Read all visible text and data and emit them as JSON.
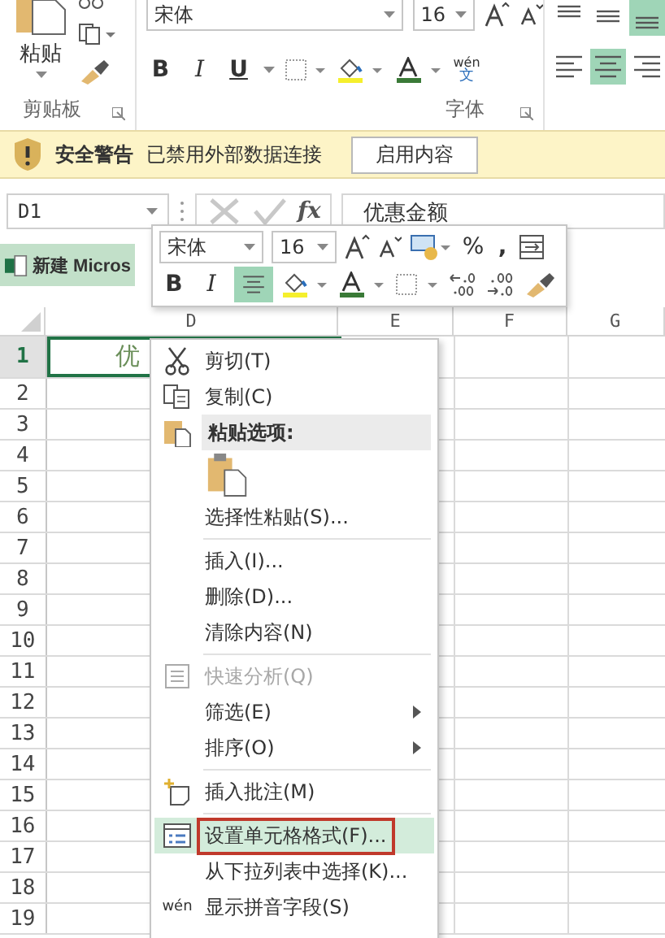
{
  "ribbon": {
    "clipboard": {
      "paste_label": "粘贴",
      "group_label": "剪贴板"
    },
    "font": {
      "font_name": "宋体",
      "font_size": "16",
      "bold": "B",
      "italic": "I",
      "underline": "U",
      "phonetic_top": "wén",
      "phonetic_bottom": "文",
      "group_label": "字体"
    },
    "alignment": [
      {
        "kind": "top",
        "selected": false
      },
      {
        "kind": "middle",
        "selected": false
      },
      {
        "kind": "bottom",
        "selected": true
      },
      {
        "kind": "left",
        "selected": false
      },
      {
        "kind": "center",
        "selected": true
      },
      {
        "kind": "right",
        "selected": false
      }
    ]
  },
  "security_bar": {
    "title": "安全警告",
    "message": "已禁用外部数据连接",
    "button": "启用内容"
  },
  "formula_bar": {
    "name_box": "D1",
    "function_label": "fx",
    "formula": "优惠金额"
  },
  "workbook_tab": "新建 Micros",
  "sheet": {
    "columns": [
      "D",
      "E",
      "F",
      "G"
    ],
    "rows": [
      "1",
      "2",
      "3",
      "4",
      "5",
      "6",
      "7",
      "8",
      "9",
      "10",
      "11",
      "12",
      "13",
      "14",
      "15",
      "16",
      "17",
      "18",
      "19"
    ],
    "cell_d1": "优"
  },
  "mini_toolbar": {
    "font_name": "宋体",
    "font_size": "16",
    "percent": "%",
    "comma": ",",
    "bold": "B",
    "italic": "I",
    "center_selected": true
  },
  "context_menu": [
    {
      "kind": "item",
      "label": "剪切(T)",
      "disabled": false,
      "submenu": false,
      "selected": false,
      "marked": false
    },
    {
      "kind": "item",
      "label": "复制(C)",
      "disabled": false,
      "submenu": false,
      "selected": false,
      "marked": false
    },
    {
      "kind": "header",
      "label": "粘贴选项:"
    },
    {
      "kind": "paste-options"
    },
    {
      "kind": "item",
      "label": "选择性粘贴(S)...",
      "disabled": false,
      "submenu": false,
      "selected": false,
      "marked": false
    },
    {
      "kind": "separator"
    },
    {
      "kind": "item",
      "label": "插入(I)...",
      "disabled": false,
      "submenu": false,
      "selected": false,
      "marked": false
    },
    {
      "kind": "item",
      "label": "删除(D)...",
      "disabled": false,
      "submenu": false,
      "selected": false,
      "marked": false
    },
    {
      "kind": "item",
      "label": "清除内容(N)",
      "disabled": false,
      "submenu": false,
      "selected": false,
      "marked": false
    },
    {
      "kind": "separator"
    },
    {
      "kind": "item",
      "label": "快速分析(Q)",
      "disabled": true,
      "submenu": false,
      "selected": false,
      "marked": false
    },
    {
      "kind": "item",
      "label": "筛选(E)",
      "disabled": false,
      "submenu": true,
      "selected": false,
      "marked": false
    },
    {
      "kind": "item",
      "label": "排序(O)",
      "disabled": false,
      "submenu": true,
      "selected": false,
      "marked": false
    },
    {
      "kind": "separator"
    },
    {
      "kind": "item",
      "label": "插入批注(M)",
      "disabled": false,
      "submenu": false,
      "selected": false,
      "marked": false
    },
    {
      "kind": "separator"
    },
    {
      "kind": "item",
      "label": "设置单元格格式(F)...",
      "disabled": false,
      "submenu": false,
      "selected": true,
      "marked": true
    },
    {
      "kind": "item",
      "label": "从下拉列表中选择(K)...",
      "disabled": false,
      "submenu": false,
      "selected": false,
      "marked": false
    },
    {
      "kind": "item",
      "label": "显示拼音字段(S)",
      "disabled": false,
      "submenu": false,
      "selected": false,
      "marked": false,
      "phonetic_icon": "wén"
    }
  ]
}
